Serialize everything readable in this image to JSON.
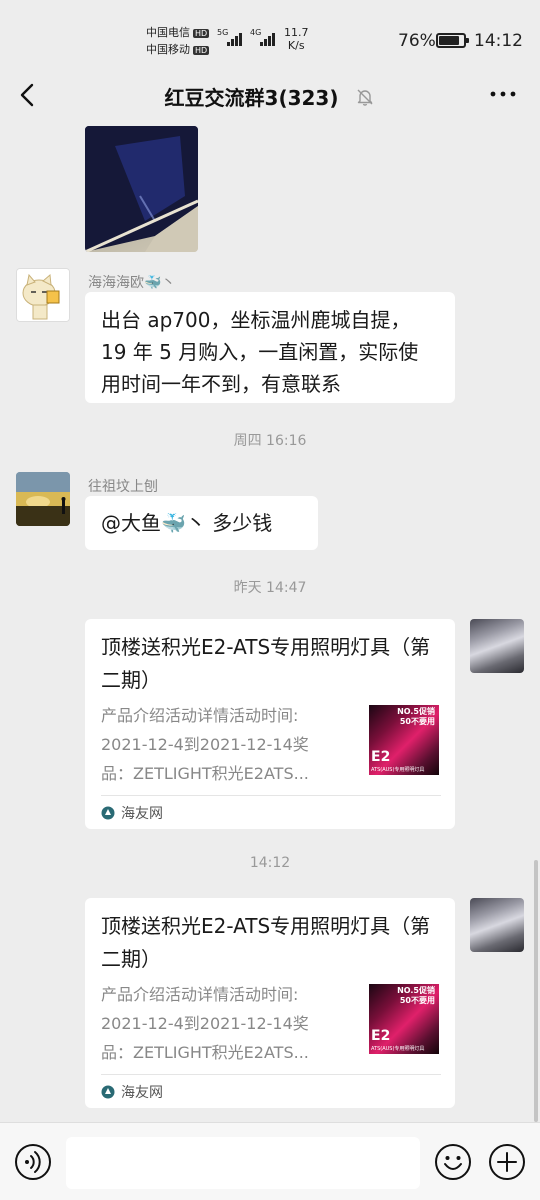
{
  "status_bar": {
    "carrier_1": "中国电信",
    "carrier_2": "中国移动",
    "hd": "HD",
    "signal_1": "5G",
    "signal_2": "4G",
    "net_speed_value": "11.7",
    "net_speed_unit": "K/s",
    "battery_percent": "76%",
    "time": "14:12"
  },
  "header": {
    "title": "红豆交流群3(323)",
    "icons": {
      "back": "chevron-left-icon",
      "mute": "bell-off-icon",
      "more": "more-dots-icon"
    }
  },
  "messages": [
    {
      "type": "image",
      "side": "left"
    },
    {
      "type": "text",
      "side": "left",
      "sender": "海海海欧🐳丶",
      "lines": [
        "出台 ap700，坐标温州鹿城自提，",
        "19 年 5 月购入，一直闲置，实际使",
        "用时间一年不到，有意联系"
      ]
    },
    {
      "type": "time",
      "text": "周四 16:16"
    },
    {
      "type": "text",
      "side": "left",
      "sender": "往祖坟上刨",
      "lines": [
        "@大鱼🐳丶  多少钱"
      ]
    },
    {
      "type": "time",
      "text": "昨天 14:47"
    },
    {
      "type": "card",
      "side": "right",
      "title": "顶楼送积光E2-ATS专用照明灯具（第二期）",
      "desc_lines": [
        "产品介绍活动详情活动时间:",
        "2021-12-4到2021-12-14奖",
        "品：ZETLIGHT积光E2ATS..."
      ],
      "thumb": {
        "top_text": "NO.5促销",
        "top_text_2": "50不要用",
        "main": "E2",
        "sub": "ATS(AUS)专用照明灯具"
      },
      "source": "海友网"
    },
    {
      "type": "time",
      "text": "14:12"
    },
    {
      "type": "card",
      "side": "right",
      "title": "顶楼送积光E2-ATS专用照明灯具（第二期）",
      "desc_lines": [
        "产品介绍活动详情活动时间:",
        "2021-12-4到2021-12-14奖",
        "品：ZETLIGHT积光E2ATS..."
      ],
      "thumb": {
        "top_text": "NO.5促销",
        "top_text_2": "50不要用",
        "main": "E2",
        "sub": "ATS(AUS)专用照明灯具"
      },
      "source": "海友网"
    }
  ],
  "input_bar": {
    "placeholder": "",
    "icons": {
      "voice": "voice-icon",
      "emoji": "emoji-icon",
      "plus": "plus-icon"
    }
  },
  "colors": {
    "background": "#ededed",
    "bubble": "#ffffff",
    "meta_text": "#999999"
  }
}
